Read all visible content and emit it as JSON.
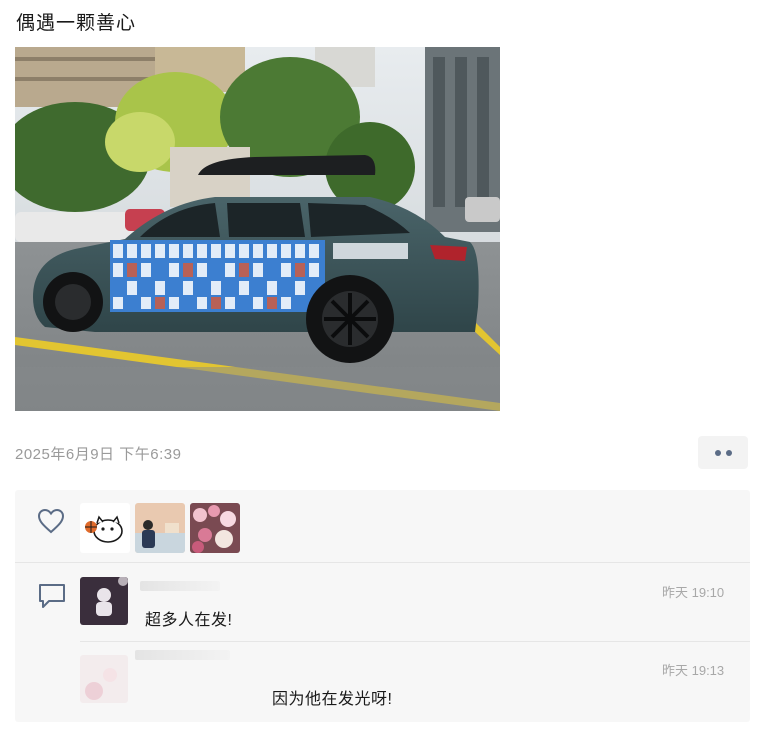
{
  "post": {
    "text": "偶遇一颗善心",
    "timestamp": "2025年6月9日 下午6:39",
    "more_icon": "more-dots-icon"
  },
  "likes": {
    "icon": "heart-icon",
    "avatars": [
      "cartoon-cat-avatar",
      "person-avatar",
      "flowers-avatar"
    ]
  },
  "comments": [
    {
      "icon": "comment-bubble-icon",
      "time": "昨天 19:10",
      "text": "超多人在发!"
    },
    {
      "time": "昨天 19:13",
      "text": "因为他在发光呀!"
    }
  ],
  "colors": {
    "meta_gray": "#9a9a9a",
    "panel_bg": "#f7f7f7",
    "dots": "#5b6c86",
    "car_body": "#3a5258"
  }
}
